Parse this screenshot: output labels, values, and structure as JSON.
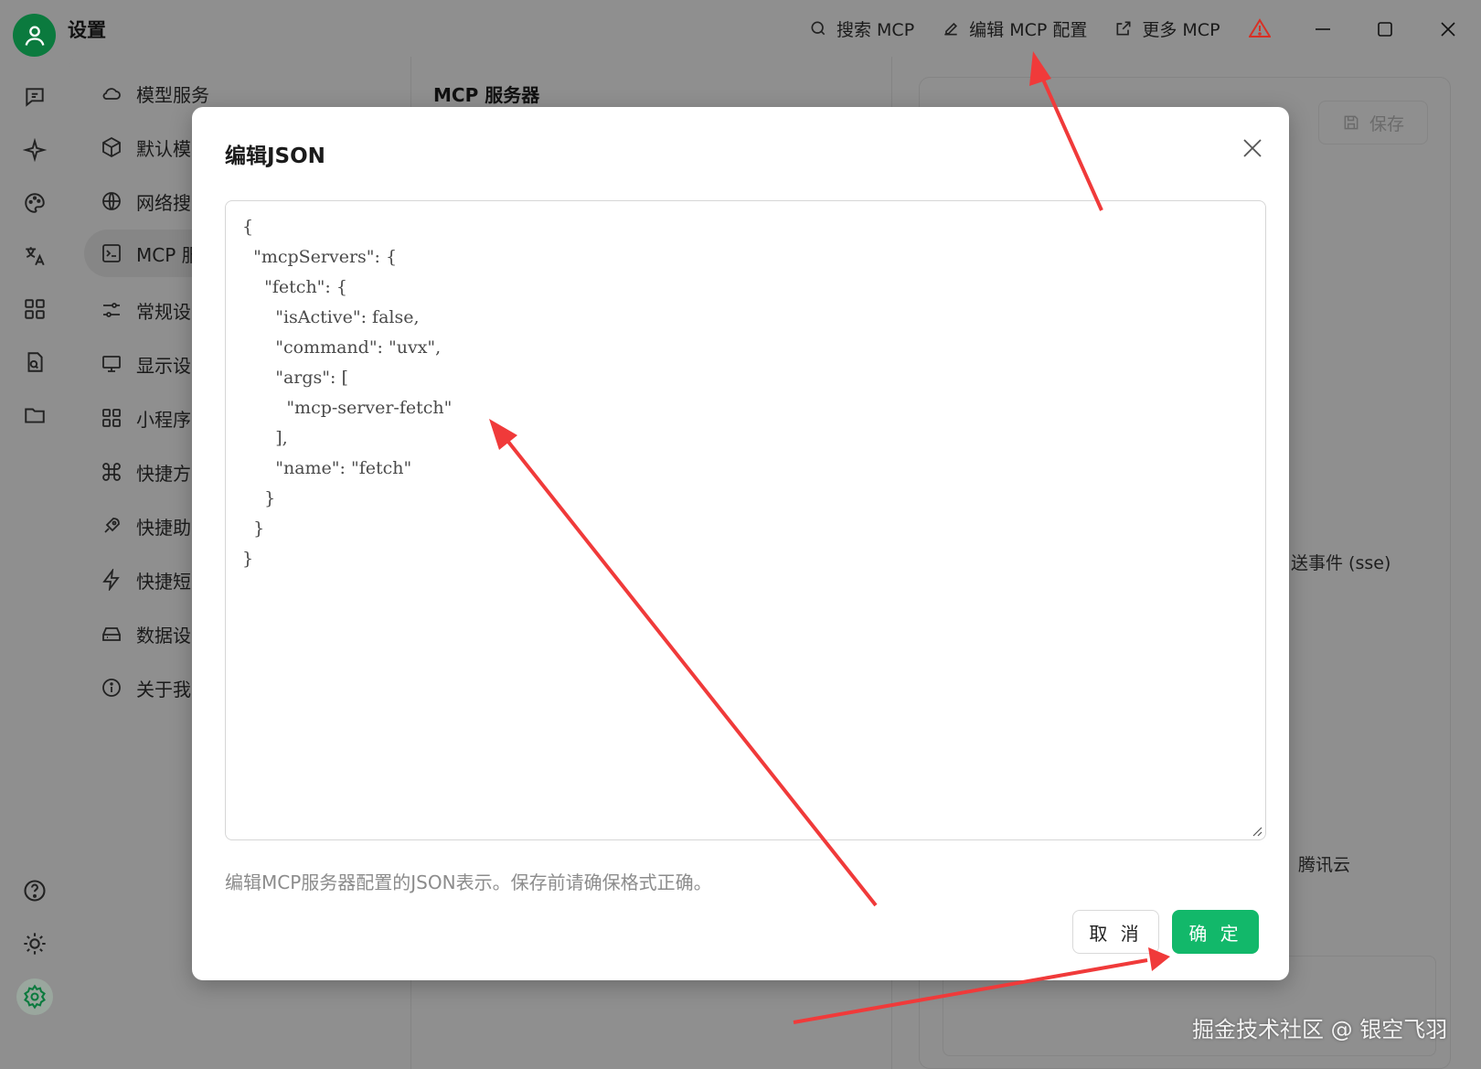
{
  "app": {
    "title": "设置",
    "top_actions": [
      {
        "label": "搜索 MCP",
        "icon": "search-icon"
      },
      {
        "label": "编辑 MCP 配置",
        "icon": "edit-icon"
      },
      {
        "label": "更多 MCP",
        "icon": "external-link-icon"
      }
    ]
  },
  "settings_nav": {
    "items": [
      {
        "label": "模型服务",
        "icon": "cloud-icon"
      },
      {
        "label": "默认模",
        "icon": "cube-icon"
      },
      {
        "label": "网络搜",
        "icon": "globe-icon"
      },
      {
        "label": "MCP 服",
        "icon": "terminal-icon"
      },
      {
        "label": "常规设",
        "icon": "sliders-icon"
      },
      {
        "label": "显示设",
        "icon": "monitor-icon"
      },
      {
        "label": "小程序",
        "icon": "grid-icon"
      },
      {
        "label": "快捷方",
        "icon": "command-icon"
      },
      {
        "label": "快捷助",
        "icon": "rocket-icon"
      },
      {
        "label": "快捷短",
        "icon": "zap-icon"
      },
      {
        "label": "数据设",
        "icon": "drive-icon"
      },
      {
        "label": "关于我",
        "icon": "info-icon"
      }
    ]
  },
  "mcp_pane": {
    "title": "MCP 服务器"
  },
  "detail": {
    "save_label": "保存",
    "transport_text": "送事件 (sse)",
    "provider_text": "腾讯云"
  },
  "modal": {
    "title": "编辑JSON",
    "json_text": "{\n  \"mcpServers\": {\n    \"fetch\": {\n      \"isActive\": false,\n      \"command\": \"uvx\",\n      \"args\": [\n        \"mcp-server-fetch\"\n      ],\n      \"name\": \"fetch\"\n    }\n  }\n}",
    "hint": "编辑MCP服务器配置的JSON表示。保存前请确保格式正确。",
    "cancel_label": "取 消",
    "ok_label": "确 定"
  },
  "watermark": "掘金技术社区 @ 银空飞羽",
  "colors": {
    "accent": "#12b86a",
    "annotation": "#f03a3a",
    "overlay": "#8f8f8f"
  }
}
